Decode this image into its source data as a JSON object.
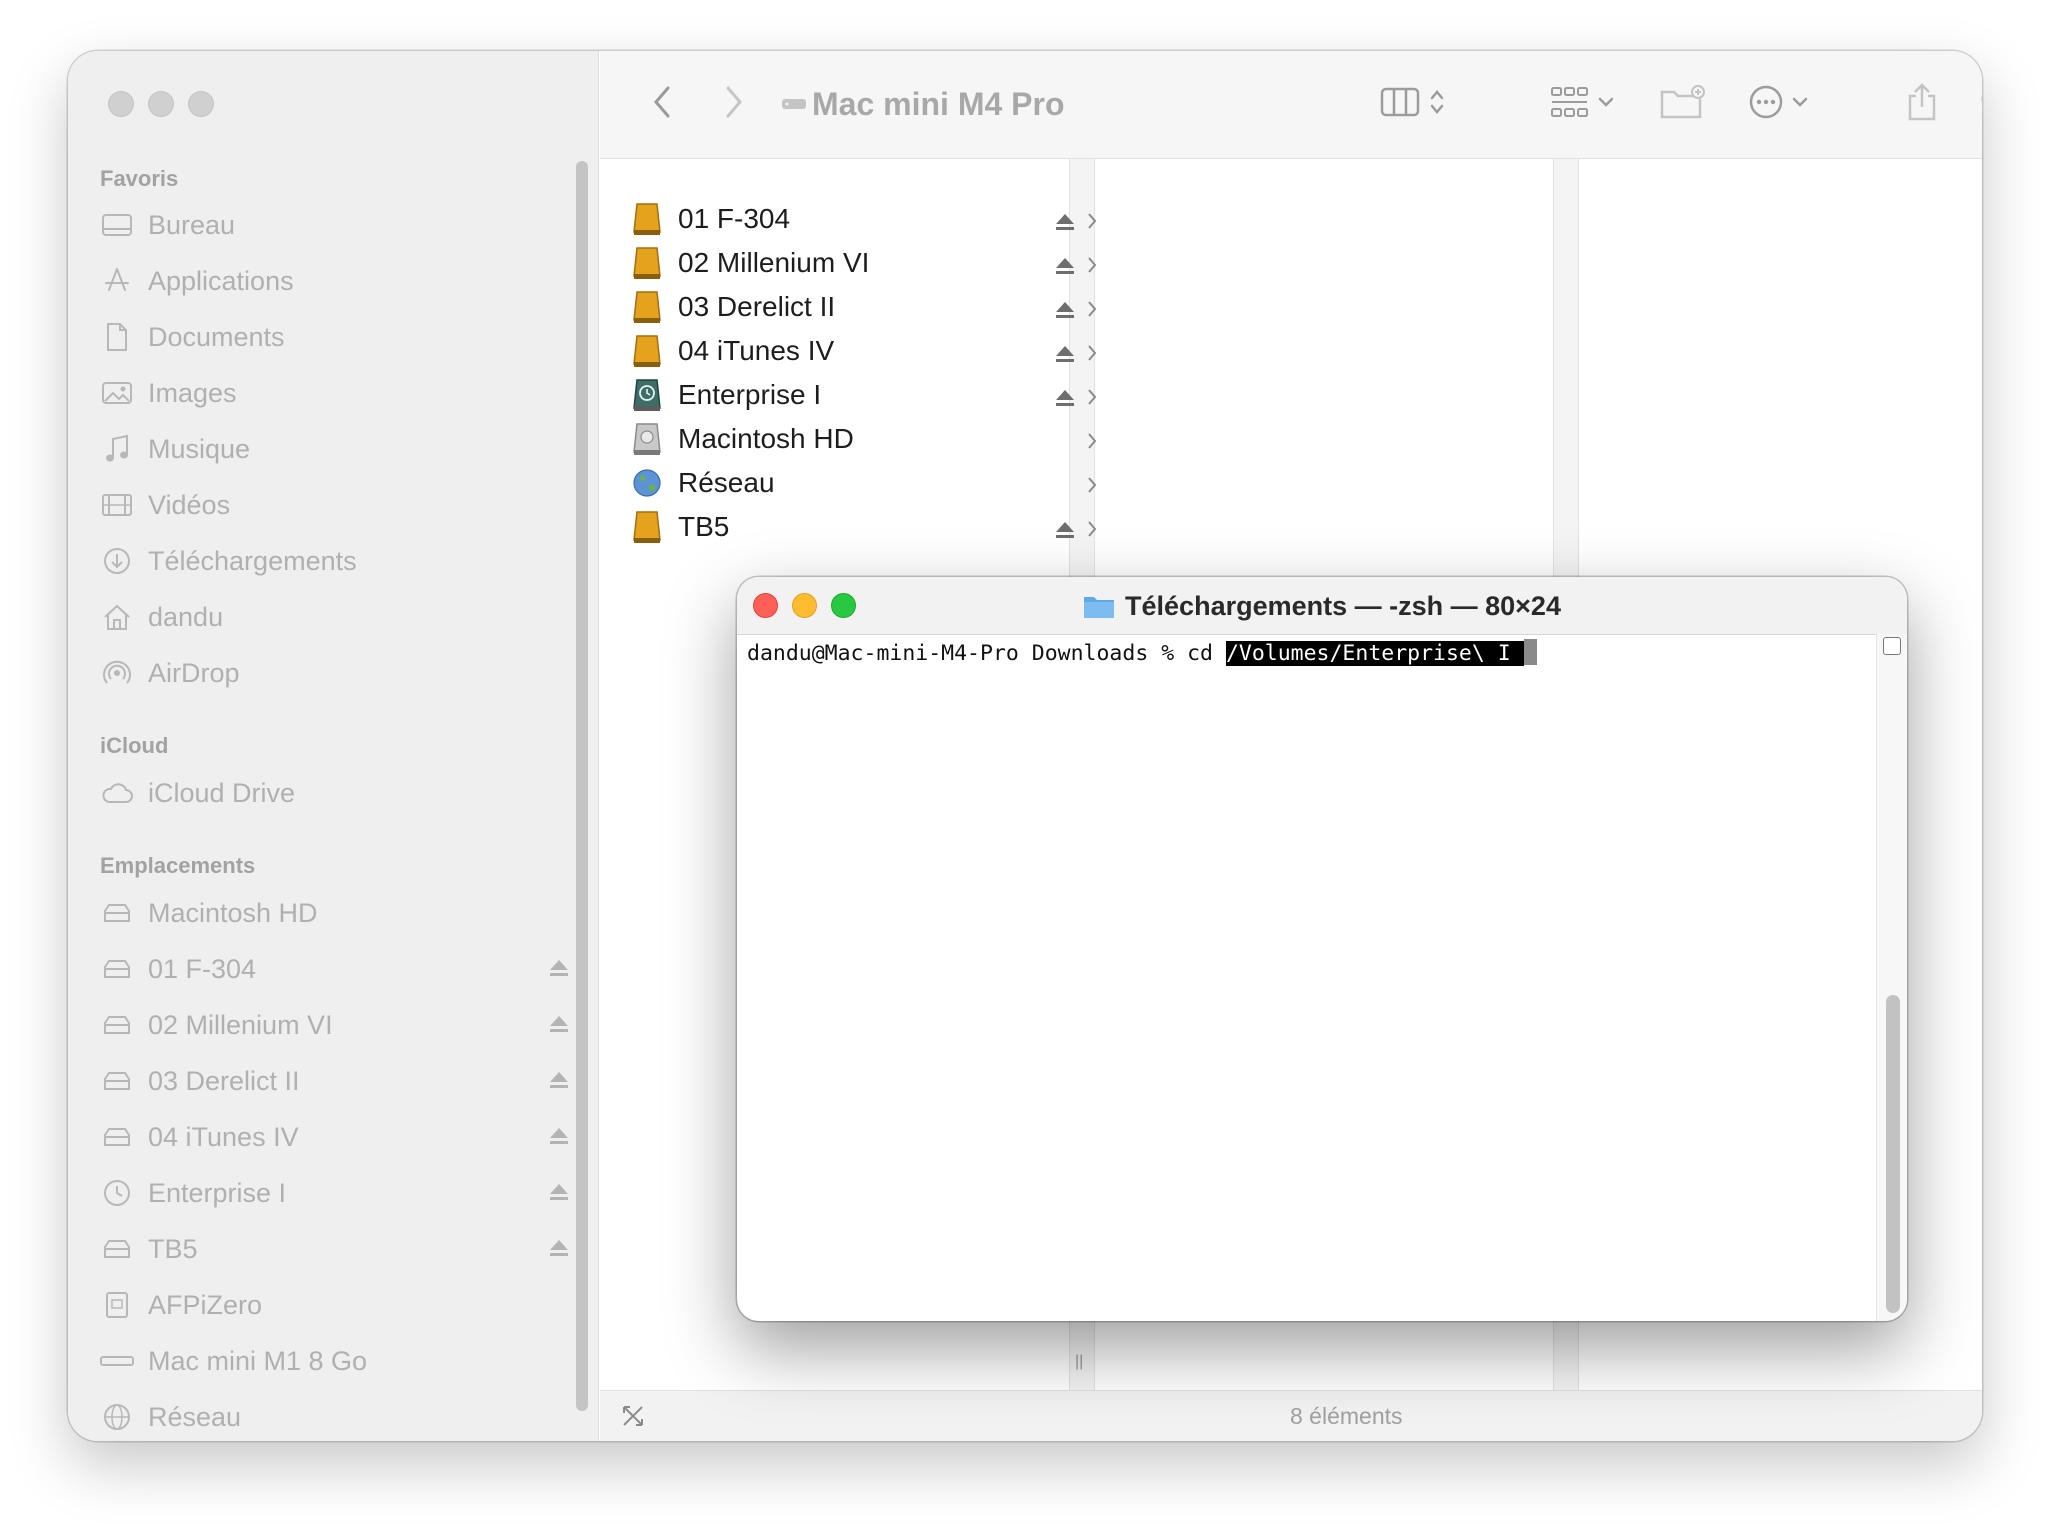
{
  "finder": {
    "title": "Mac mini M4 Pro",
    "sidebar": {
      "favorites_label": "Favoris",
      "favorites": [
        {
          "label": "Bureau",
          "icon": "desktop-icon"
        },
        {
          "label": "Applications",
          "icon": "applications-icon"
        },
        {
          "label": "Documents",
          "icon": "document-icon"
        },
        {
          "label": "Images",
          "icon": "photo-icon"
        },
        {
          "label": "Musique",
          "icon": "music-icon"
        },
        {
          "label": "Vidéos",
          "icon": "film-icon"
        },
        {
          "label": "Téléchargements",
          "icon": "download-icon"
        },
        {
          "label": "dandu",
          "icon": "home-icon"
        },
        {
          "label": "AirDrop",
          "icon": "airdrop-icon"
        }
      ],
      "icloud_label": "iCloud",
      "icloud": [
        {
          "label": "iCloud Drive",
          "icon": "cloud-icon"
        }
      ],
      "locations_label": "Emplacements",
      "locations": [
        {
          "label": "Macintosh HD",
          "icon": "drive-icon",
          "eject": false
        },
        {
          "label": "01 F-304",
          "icon": "drive-icon",
          "eject": true
        },
        {
          "label": "02 Millenium VI",
          "icon": "drive-icon",
          "eject": true
        },
        {
          "label": "03 Derelict II",
          "icon": "drive-icon",
          "eject": true
        },
        {
          "label": "04 iTunes IV",
          "icon": "drive-icon",
          "eject": true
        },
        {
          "label": "Enterprise I",
          "icon": "time-machine-icon",
          "eject": true
        },
        {
          "label": "TB5",
          "icon": "drive-icon",
          "eject": true
        },
        {
          "label": "AFPiZero",
          "icon": "server-icon",
          "eject": false
        },
        {
          "label": "Mac mini M1 8 Go",
          "icon": "mac-mini-icon",
          "eject": false
        },
        {
          "label": "Réseau",
          "icon": "network-icon",
          "eject": false
        }
      ]
    },
    "volumes": [
      {
        "label": "01 F-304",
        "icon": "external-drive-icon",
        "eject": true
      },
      {
        "label": "02 Millenium VI",
        "icon": "external-drive-icon",
        "eject": true
      },
      {
        "label": "03 Derelict II",
        "icon": "external-drive-icon",
        "eject": true
      },
      {
        "label": "04 iTunes IV",
        "icon": "external-drive-icon",
        "eject": true
      },
      {
        "label": "Enterprise I",
        "icon": "time-machine-icon",
        "eject": true
      },
      {
        "label": "Macintosh HD",
        "icon": "internal-drive-icon",
        "eject": false
      },
      {
        "label": "Réseau",
        "icon": "globe-icon",
        "eject": false
      },
      {
        "label": "TB5",
        "icon": "external-drive-icon",
        "eject": true
      }
    ],
    "status": "8 éléments"
  },
  "terminal": {
    "title": "Téléchargements — -zsh — 80×24",
    "prompt": "dandu@Mac-mini-M4-Pro Downloads % cd ",
    "selected_text": "/Volumes/Enterprise\\ I "
  },
  "colors": {
    "close": "#ff5f57",
    "minimize": "#febc2e",
    "zoom": "#28c840",
    "drive": "#e5a21d",
    "folder": "#5fa9e8"
  }
}
